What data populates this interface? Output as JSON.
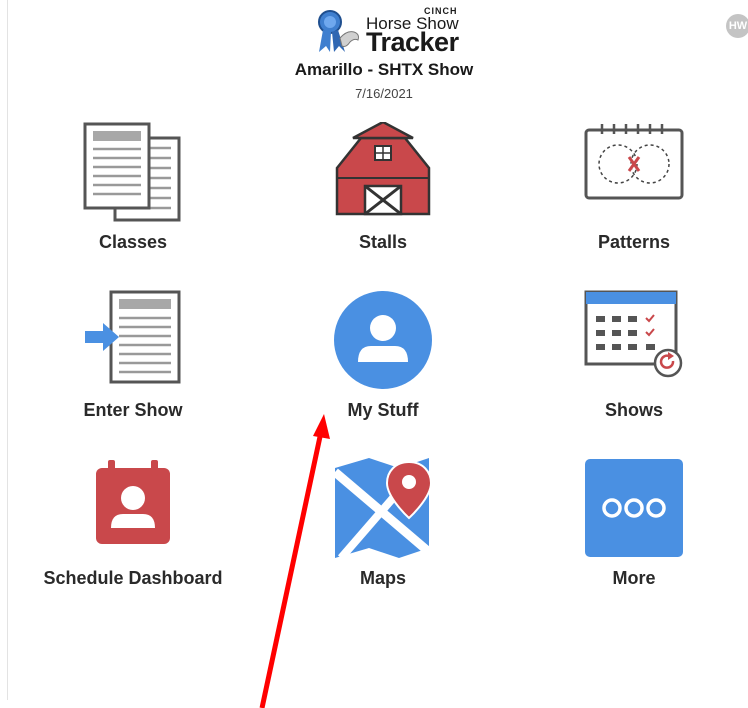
{
  "header": {
    "logo_brand": "CINCH",
    "logo_line1": "Horse Show",
    "logo_line2": "Tracker",
    "show_name": "Amarillo - SHTX Show",
    "show_date": "7/16/2021",
    "corner_badge": "HW"
  },
  "tiles": [
    {
      "label": "Classes",
      "icon": "documents-icon"
    },
    {
      "label": "Stalls",
      "icon": "barn-icon"
    },
    {
      "label": "Patterns",
      "icon": "pattern-icon"
    },
    {
      "label": "Enter Show",
      "icon": "enter-show-icon"
    },
    {
      "label": "My Stuff",
      "icon": "user-icon"
    },
    {
      "label": "Shows",
      "icon": "calendar-icon"
    },
    {
      "label": "Schedule Dashboard",
      "icon": "schedule-icon"
    },
    {
      "label": "Maps",
      "icon": "map-icon"
    },
    {
      "label": "More",
      "icon": "more-icon"
    }
  ],
  "colors": {
    "blue": "#4a90e2",
    "red": "#c9484b",
    "annotation_arrow": "#ff0000"
  }
}
